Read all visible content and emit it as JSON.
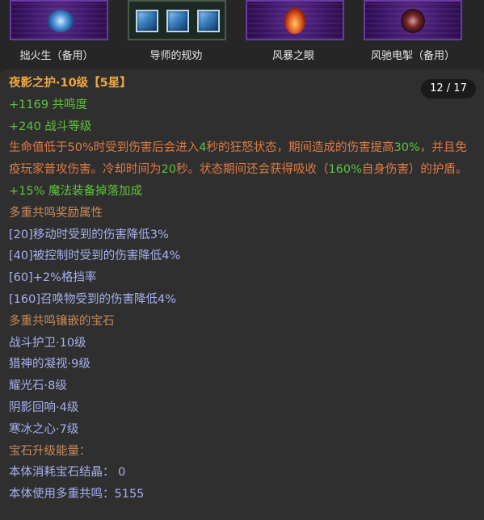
{
  "items": [
    {
      "label": "拙火生（备用）",
      "icon": "blue-swirl-rune-icon"
    },
    {
      "label": "导师的规劝",
      "icon": "three-blue-gems-icon"
    },
    {
      "label": "风暴之眼",
      "icon": "flame-rune-icon"
    },
    {
      "label": "风驰电掣（备用）",
      "icon": "dark-orb-rune-icon"
    }
  ],
  "tooltip": {
    "page_indicator": "12 / 17",
    "title": "夜影之护·10级【5星】",
    "stat1": "+1169 共鸣度",
    "stat2": "+240 战斗等级",
    "desc": {
      "p1": "生命值低于50%时受到伤害后会进入",
      "v1": "4",
      "p2": "秒的狂怒状态，期间造成的伤害提高",
      "v2": "30%",
      "p3": "，并且免疫玩家普攻伤害。冷却时间为",
      "v3": "20",
      "p4": "秒。状态期间还会获得吸收（",
      "v4": "160%",
      "p5": "自身伤害）的护盾。"
    },
    "stat3": "+15% 魔法装备掉落加成",
    "bonus_header": "多重共鸣奖励属性",
    "bonuses": [
      "[20]移动时受到的伤害降低3%",
      "[40]被控制时受到的伤害降低4%",
      "[60]+2%格挡率",
      "[160]召唤物受到的伤害降低4%"
    ],
    "gems_header": "多重共鸣镶嵌的宝石",
    "gems": [
      "战斗护卫·10级",
      "猎神的凝视·9级",
      "耀光石·8级",
      "阴影回响·4级",
      "寒冰之心·7级"
    ],
    "upgrade_header": "宝石升级能量：",
    "upgrade_lines": [
      "本体消耗宝石结晶： 0",
      "本体使用多重共鸣：5155"
    ]
  }
}
